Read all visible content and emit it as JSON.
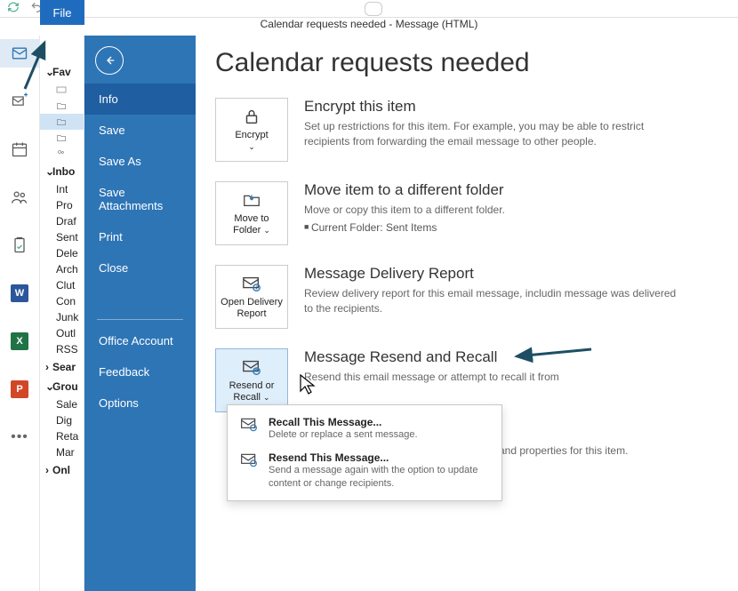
{
  "titlebar": "Calendar requests needed  -  Message (HTML)",
  "file_tab_label": "File",
  "nav": {
    "new_mail_icon": "new-mail"
  },
  "folders": {
    "group1": "Fav",
    "items1": [
      "",
      "",
      "",
      "",
      ""
    ],
    "group2": "Inbo",
    "items2": [
      "Int",
      "Pro",
      "Draf",
      "Sent",
      "Dele",
      "Arch",
      "Clut",
      "Con",
      "Junk",
      "Outl",
      "RSS"
    ],
    "group3": "Sear",
    "group4": "Grou",
    "items4": [
      "Sale",
      "Dig",
      "Reta",
      "Mar"
    ],
    "group5": "Onl"
  },
  "file_menu": {
    "back": "back",
    "items": [
      "Info",
      "Save",
      "Save As",
      "Save Attachments",
      "Print",
      "Close"
    ],
    "bottom": [
      "Office Account",
      "Feedback",
      "Options"
    ]
  },
  "page_title": "Calendar requests needed",
  "sections": [
    {
      "tile_label": "Encrypt",
      "tile_caret": true,
      "title": "Encrypt this item",
      "body": "Set up restrictions for this item. For example, you may be able to restrict recipients from forwarding the email message to other people."
    },
    {
      "tile_label": "Move to Folder",
      "tile_caret": true,
      "title": "Move item to a different folder",
      "body": "Move or copy this item to a different folder.",
      "list": [
        "Current Folder:   Sent Items"
      ]
    },
    {
      "tile_label": "Open Delivery Report",
      "tile_caret": false,
      "title": "Message Delivery Report",
      "body": "Review delivery report for this email message, includin message was delivered to the recipients."
    },
    {
      "tile_label": "Resend or Recall",
      "tile_caret": true,
      "title": "Message Resend and Recall",
      "body": "Resend this email message or attempt to recall it from"
    }
  ],
  "orphan_text": "and properties for this item.",
  "popup": [
    {
      "title": "Recall This Message...",
      "body": "Delete or replace a sent message."
    },
    {
      "title": "Resend This Message...",
      "body": "Send a message again with the option to update content or change recipients."
    }
  ]
}
